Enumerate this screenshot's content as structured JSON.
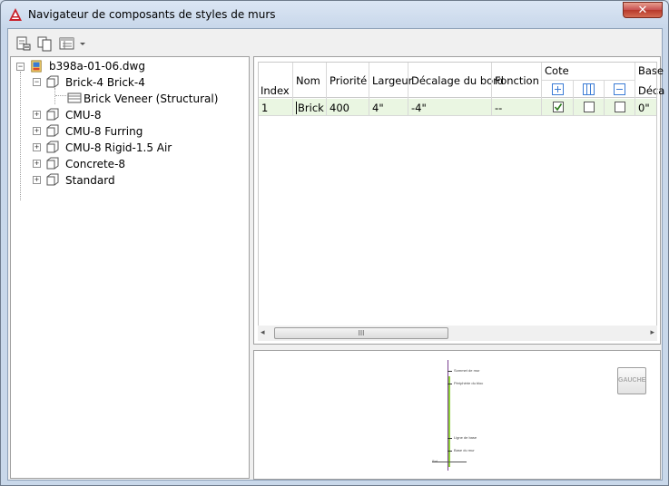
{
  "window": {
    "title": "Navigateur de composants de styles de murs",
    "close_glyph": "✕"
  },
  "toolbar": {
    "buttons": [
      {
        "icon": "import-icon"
      },
      {
        "icon": "copy-icon"
      },
      {
        "icon": "view-options-icon",
        "dropdown": true
      }
    ]
  },
  "tree": {
    "root": {
      "label": "b398a-01-06.dwg",
      "expanded": true
    },
    "items": [
      {
        "label": "Brick-4 Brick-4",
        "expanded": true,
        "children": [
          {
            "label": "Brick Veneer (Structural)"
          }
        ]
      },
      {
        "label": "CMU-8",
        "expanded": false
      },
      {
        "label": "CMU-8 Furring",
        "expanded": false
      },
      {
        "label": "CMU-8 Rigid-1.5 Air",
        "expanded": false
      },
      {
        "label": "Concrete-8",
        "expanded": false
      },
      {
        "label": "Standard",
        "expanded": false
      }
    ]
  },
  "grid": {
    "headers": {
      "index": "Index",
      "nom": "Nom",
      "priorite": "Priorité",
      "largeur": "Largeur",
      "decalage": "Décalage du bord",
      "fonction": "Fonction",
      "cote": "Cote",
      "base": "Base",
      "base_sub": "Déca"
    },
    "row": {
      "index": "1",
      "nom": "Brick...",
      "priorite": "400",
      "largeur": "4\"",
      "decalage": "-4\"",
      "fonction": "--",
      "base": "0\""
    },
    "scroll_grip": "III",
    "scroll_left": "◂",
    "scroll_right": "▸"
  },
  "preview": {
    "button_label": "GAUCHE",
    "labels": [
      "Sommet de mur",
      "Périphérie du bloc",
      "Ligne de base",
      "Base du mur",
      "Sol"
    ]
  },
  "colors": {
    "accent_green": "#8ed13a",
    "accent_purple": "#7a3f8f",
    "app_red": "#c8202a"
  }
}
